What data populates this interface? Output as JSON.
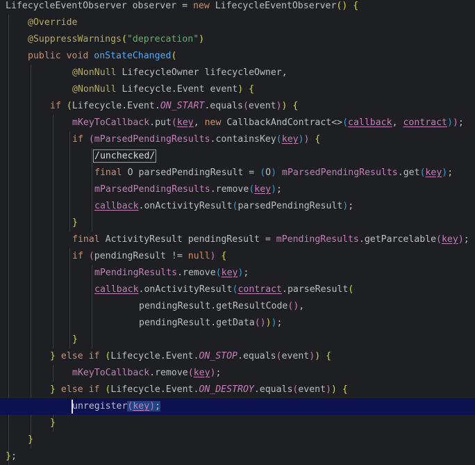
{
  "editor": {
    "language": "Java",
    "background": "#1e1f22",
    "current_line_color": "#0d1150",
    "highlighted_line": 25,
    "palette": {
      "keyword": "#cf8e6d",
      "annotation": "#b3ae60",
      "string": "#6aab73",
      "field": "#c77dbb",
      "method": "#56a8f5",
      "text": "#bcbec4"
    },
    "lines": [
      [
        [
          "",
          "LifecycleEventObserver observer = "
        ],
        [
          "kw",
          "new "
        ],
        [
          "",
          "LifecycleEventObserver"
        ],
        [
          "pb",
          "() {"
        ]
      ],
      [
        [
          "ann",
          "@Override"
        ]
      ],
      [
        [
          "ann",
          "@SuppressWarnings"
        ],
        [
          "pb",
          "("
        ],
        [
          "str",
          "\"deprecation\""
        ],
        [
          "pb",
          ")"
        ]
      ],
      [
        [
          "kw",
          "public void "
        ],
        [
          "mth",
          "onStateChanged"
        ],
        [
          "pb",
          "("
        ]
      ],
      [
        [
          "ann",
          "@NonNull "
        ],
        [
          "",
          "LifecycleOwner lifecycleOwner,"
        ]
      ],
      [
        [
          "ann",
          "@NonNull "
        ],
        [
          "",
          "Lifecycle.Event event"
        ],
        [
          "pb",
          ") {"
        ]
      ],
      [
        [
          "kw",
          "if "
        ],
        [
          "pb",
          "("
        ],
        [
          "",
          "Lifecycle.Event."
        ],
        [
          "fld it",
          "ON_START"
        ],
        [
          "",
          ".equals"
        ],
        [
          "pv",
          "("
        ],
        [
          "",
          "event"
        ],
        [
          "pv",
          ")"
        ],
        [
          "pb",
          ") {"
        ]
      ],
      [
        [
          "fld",
          "mKeyToCallback"
        ],
        [
          "",
          ".put"
        ],
        [
          "pv",
          "("
        ],
        [
          "fld ul",
          "key"
        ],
        [
          "",
          " , "
        ],
        [
          "kw",
          "new "
        ],
        [
          "",
          "CallbackAndContract<>"
        ],
        [
          "pc",
          "("
        ],
        [
          "fld ul",
          "callback"
        ],
        [
          "",
          ", "
        ],
        [
          "fld ul",
          "contract"
        ],
        [
          "pc",
          ")"
        ],
        [
          "pv",
          ")"
        ],
        [
          "",
          ";"
        ]
      ],
      [
        [
          "kw",
          "if "
        ],
        [
          "pv",
          "("
        ],
        [
          "fld",
          "mParsedPendingResults"
        ],
        [
          "",
          ".containsKey"
        ],
        [
          "pc",
          "("
        ],
        [
          "fld ul",
          "key"
        ],
        [
          "pc",
          ")"
        ],
        [
          "pv",
          ")"
        ],
        [
          "pb",
          " {"
        ]
      ],
      [
        [
          "box",
          "/unchecked/"
        ]
      ],
      [
        [
          "kw",
          "final "
        ],
        [
          "",
          "O parsedPendingResult = "
        ],
        [
          "pc",
          "("
        ],
        [
          "",
          "O"
        ],
        [
          "pc",
          ")"
        ],
        [
          "",
          " "
        ],
        [
          "fld",
          "mParsedPendingResults"
        ],
        [
          "",
          ".get"
        ],
        [
          "pc",
          "("
        ],
        [
          "fld ul",
          "key"
        ],
        [
          "pc",
          ")"
        ],
        [
          "",
          ";"
        ]
      ],
      [
        [
          "fld",
          "mParsedPendingResults"
        ],
        [
          "",
          ".remove"
        ],
        [
          "pc",
          "("
        ],
        [
          "fld ul",
          "key"
        ],
        [
          "pc",
          ")"
        ],
        [
          "",
          ";"
        ]
      ],
      [
        [
          "fld ul",
          "callback"
        ],
        [
          "",
          ".onActivityResult"
        ],
        [
          "pc",
          "("
        ],
        [
          "",
          "parsedPendingResult"
        ],
        [
          "pc",
          ")"
        ],
        [
          "",
          ";"
        ]
      ],
      [
        [
          "pb",
          "}"
        ]
      ],
      [
        [
          "kw",
          "final "
        ],
        [
          "",
          "ActivityResult pendingResult = "
        ],
        [
          "fld",
          "mPendingResults"
        ],
        [
          "",
          ".getParcelable"
        ],
        [
          "pv",
          "("
        ],
        [
          "fld ul",
          "key"
        ],
        [
          "pv",
          ")"
        ],
        [
          "",
          ";"
        ]
      ],
      [
        [
          "kw",
          "if "
        ],
        [
          "pv",
          "("
        ],
        [
          "",
          "pendingResult != "
        ],
        [
          "kw",
          "null"
        ],
        [
          "pv",
          ")"
        ],
        [
          "pb",
          " {"
        ]
      ],
      [
        [
          "fld",
          "mPendingResults"
        ],
        [
          "",
          ".remove"
        ],
        [
          "pc",
          "("
        ],
        [
          "fld ul",
          "key"
        ],
        [
          "pc",
          ")"
        ],
        [
          "",
          ";"
        ]
      ],
      [
        [
          "fld ul",
          "callback"
        ],
        [
          "",
          ".onActivityResult"
        ],
        [
          "pc",
          "("
        ],
        [
          "fld ul",
          "contract"
        ],
        [
          "",
          ".parseResult"
        ],
        [
          "pb",
          "("
        ]
      ],
      [
        [
          "",
          "pendingResult.getResultCode"
        ],
        [
          "pv",
          "()"
        ],
        [
          "",
          ","
        ]
      ],
      [
        [
          "",
          "pendingResult.getData"
        ],
        [
          "pv",
          "()"
        ],
        [
          "pb",
          ")"
        ],
        [
          "pc",
          ")"
        ],
        [
          "",
          ";"
        ]
      ],
      [
        [
          "pb",
          "}"
        ]
      ],
      [
        [
          "pb",
          "} "
        ],
        [
          "kw",
          "else if "
        ],
        [
          "pb",
          "("
        ],
        [
          "",
          "Lifecycle.Event."
        ],
        [
          "fld it",
          "ON_STOP"
        ],
        [
          "",
          ".equals"
        ],
        [
          "pv",
          "("
        ],
        [
          "",
          "event"
        ],
        [
          "pv",
          ")"
        ],
        [
          "pb",
          ") {"
        ]
      ],
      [
        [
          "fld",
          "mKeyToCallback"
        ],
        [
          "",
          ".remove"
        ],
        [
          "pv",
          "("
        ],
        [
          "fld ul",
          "key"
        ],
        [
          "pv",
          ")"
        ],
        [
          "",
          ";"
        ]
      ],
      [
        [
          "pb",
          "} "
        ],
        [
          "kw",
          "else if "
        ],
        [
          "pb",
          "("
        ],
        [
          "",
          "Lifecycle.Event."
        ],
        [
          "fld it",
          "ON_DESTROY"
        ],
        [
          "",
          ".equals"
        ],
        [
          "pv",
          "("
        ],
        [
          "",
          "event"
        ],
        [
          "pv",
          ")"
        ],
        [
          "pb",
          ") {"
        ]
      ],
      [
        [
          "",
          "unregister"
        ],
        [
          "pv",
          "("
        ],
        [
          "fld ul",
          "key"
        ],
        [
          "pv",
          ")"
        ],
        [
          "",
          ";"
        ]
      ],
      [
        [
          "pb",
          "}"
        ]
      ],
      [
        [
          "pb",
          "}"
        ]
      ],
      [
        [
          "pb",
          "}"
        ],
        [
          "",
          ";"
        ]
      ]
    ]
  }
}
